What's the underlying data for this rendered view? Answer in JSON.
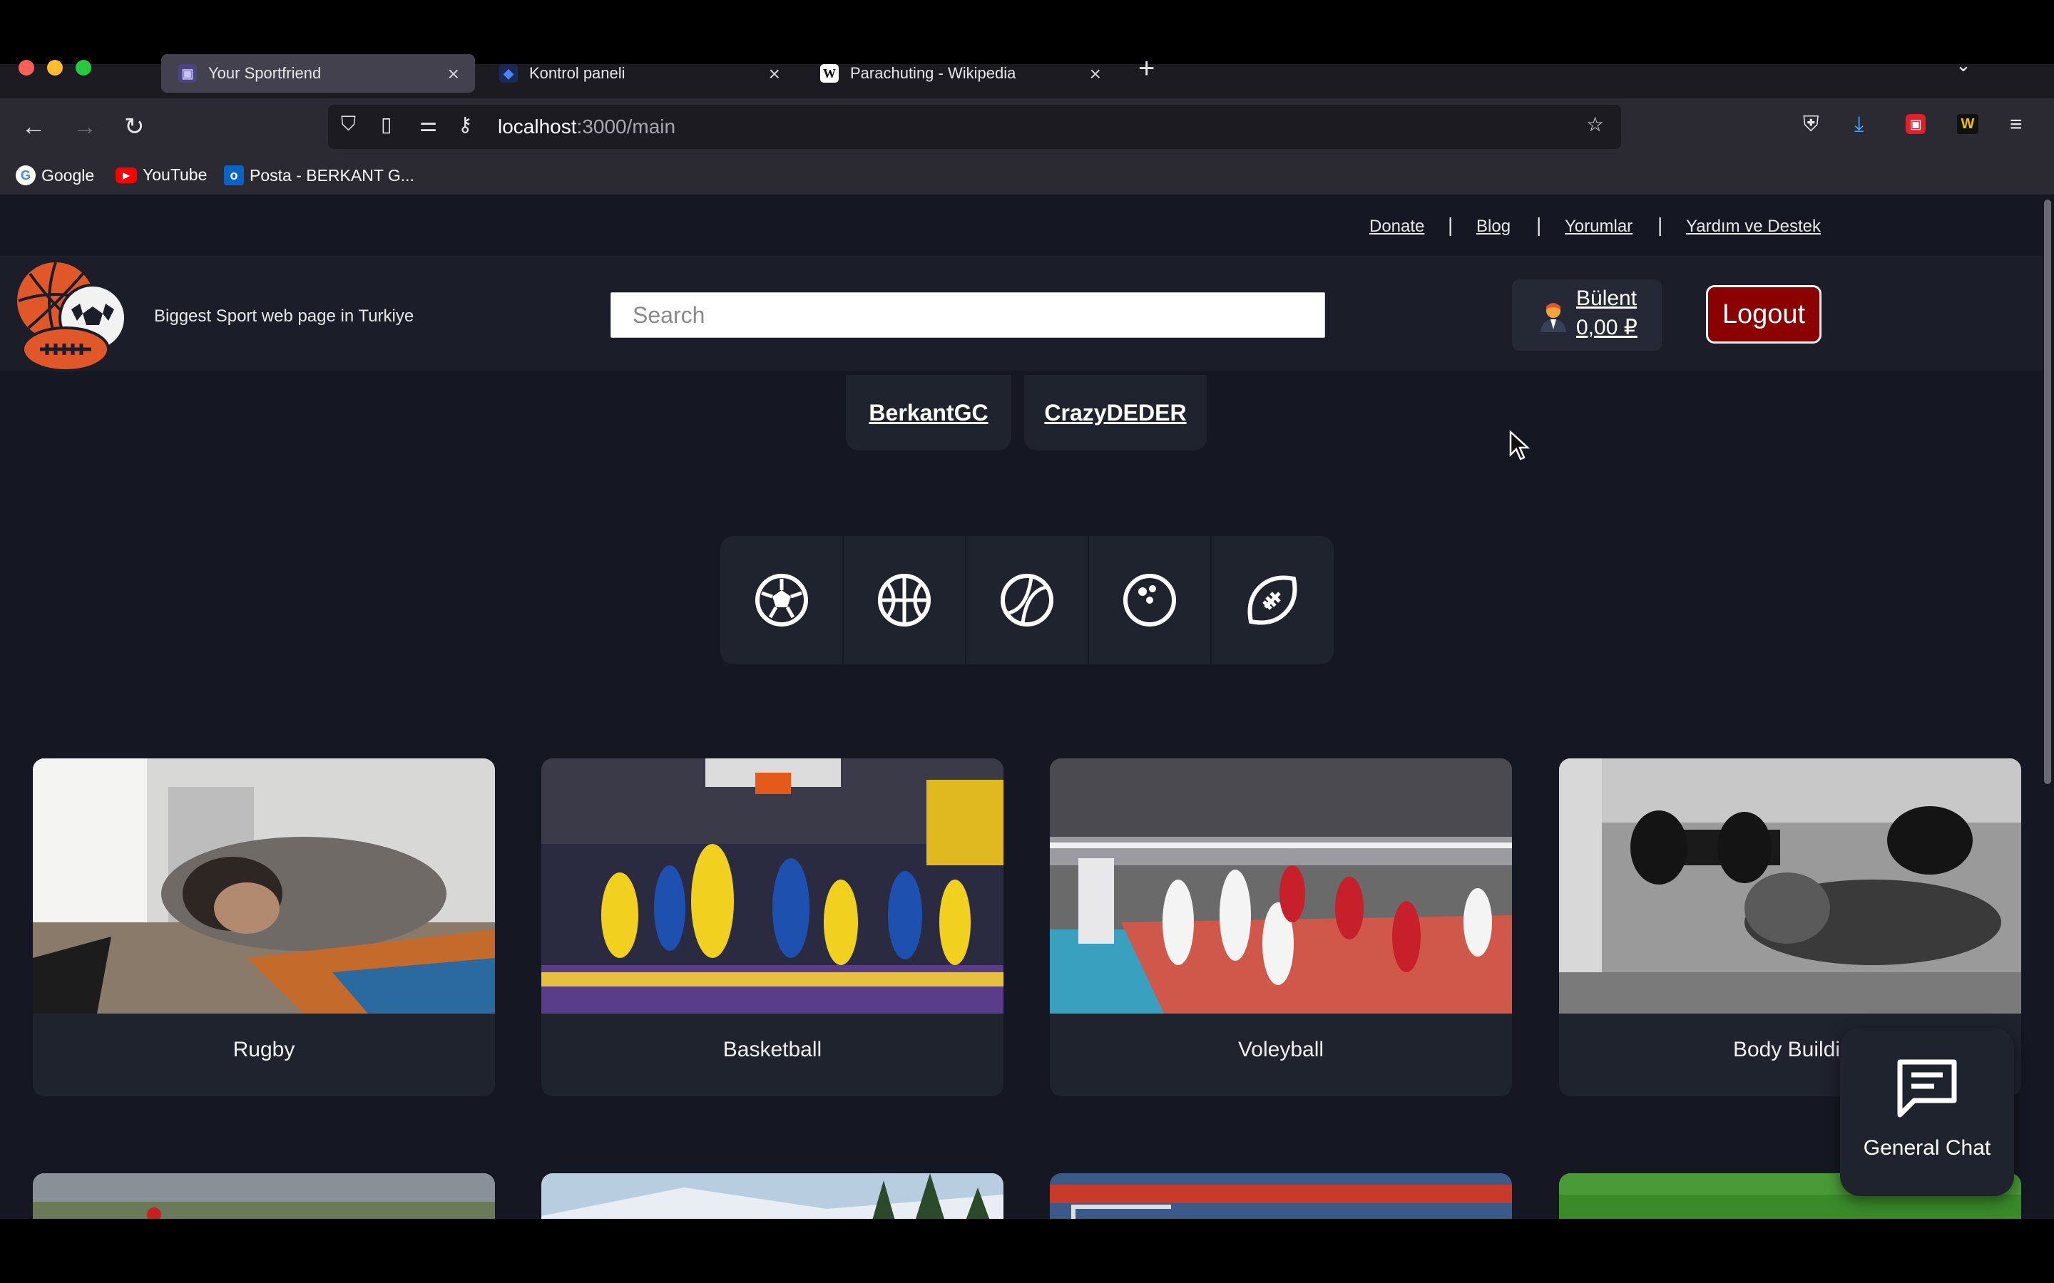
{
  "browser": {
    "tabs": [
      {
        "label": "Your Sportfriend",
        "active": true,
        "favicon": "sportfriend-favicon"
      },
      {
        "label": "Kontrol paneli",
        "active": false,
        "favicon": "shield-favicon"
      },
      {
        "label": "Parachuting - Wikipedia",
        "active": false,
        "favicon": "W"
      }
    ],
    "url_host": "localhost",
    "url_rest": ":3000/main",
    "bookmarks": [
      {
        "label": "Google",
        "icon": "G"
      },
      {
        "label": "YouTube",
        "icon": "▶"
      },
      {
        "label": "Posta - BERKANT G...",
        "icon": "o"
      }
    ]
  },
  "topnav": {
    "links": [
      "Donate",
      "Blog",
      "Yorumlar",
      "Yardım ve Destek"
    ],
    "separator": "|"
  },
  "header": {
    "tagline": "Biggest Sport web page in Turkiye",
    "search_placeholder": "Search",
    "user_name": "Bülent",
    "user_balance": "0,00 ₽",
    "logout_label": "Logout"
  },
  "friends": [
    "BerkantGC",
    "CrazyDEDER"
  ],
  "sport_filters": [
    "soccer-ball-icon",
    "basketball-icon",
    "tennis-ball-icon",
    "bowling-ball-icon",
    "football-icon"
  ],
  "cards": [
    {
      "label": "Rugby"
    },
    {
      "label": "Basketball"
    },
    {
      "label": "Voleyball"
    },
    {
      "label": "Body Buildir"
    }
  ],
  "chat": {
    "label": "General Chat"
  },
  "colors": {
    "page_bg": "#151822",
    "panel_bg": "#1f232e",
    "logout_bg": "#8b0000"
  }
}
